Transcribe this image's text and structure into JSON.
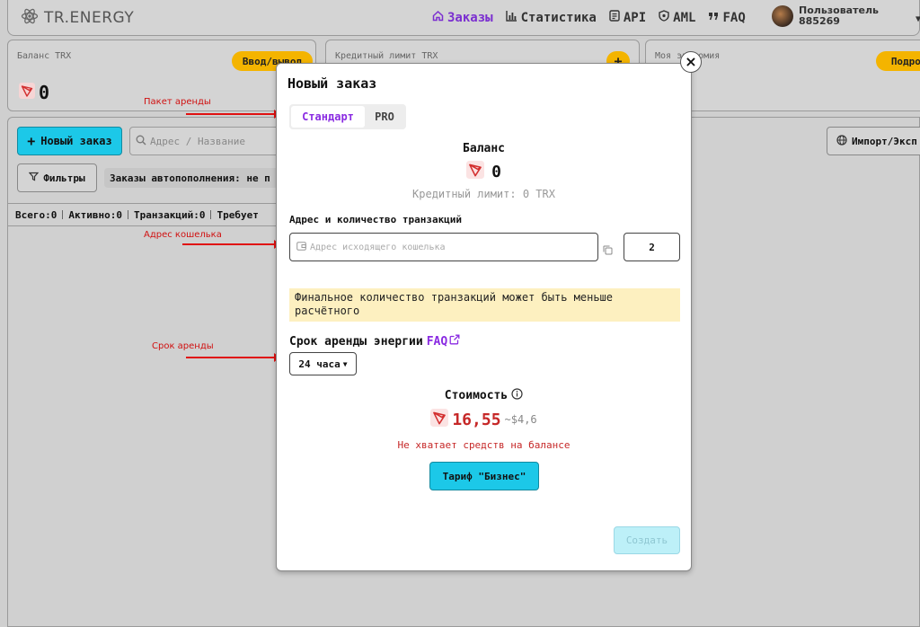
{
  "header": {
    "logo": "TR.ENERGY",
    "nav": [
      {
        "label": "Заказы",
        "icon": "home-icon",
        "active": true
      },
      {
        "label": "Статистика",
        "icon": "bar-chart-icon",
        "active": false
      },
      {
        "label": "API",
        "icon": "document-icon",
        "active": false
      },
      {
        "label": "AML",
        "icon": "shield-icon",
        "active": false
      },
      {
        "label": "FAQ",
        "icon": "quote-icon",
        "active": false
      }
    ],
    "user": {
      "line1": "Пользователь",
      "line2": "885269"
    }
  },
  "cards": [
    {
      "label": "Баланс TRX",
      "button": "Ввод/вывод",
      "value": "0"
    },
    {
      "label": "Кредитный лимит TRX",
      "button": "+"
    },
    {
      "label": "Моя экономия",
      "button": "Подробн"
    }
  ],
  "toolbar": {
    "new_order": "Новый заказ",
    "search_placeholder": "Адрес / Название",
    "import": "Импорт/Эксп",
    "filters": "Фильтры",
    "autofill_chip": "Заказы автопополнения: не п"
  },
  "stats": [
    {
      "label": "Всего:",
      "value": "0"
    },
    {
      "label": "Активно:",
      "value": "0"
    },
    {
      "label": "Транзакций:",
      "value": "0"
    },
    {
      "label": "Требует",
      "value": ""
    }
  ],
  "annotations": {
    "package": "Пакет аренды",
    "wallet": "Адрес кошелька",
    "term": "Срок аренды"
  },
  "modal": {
    "title": "Новый заказ",
    "tabs": [
      {
        "label": "Стандарт",
        "active": true
      },
      {
        "label": "PRO",
        "active": false
      }
    ],
    "balance_label": "Баланс",
    "balance_value": "0",
    "credit_limit": "Кредитный лимит: 0 TRX",
    "address_label": "Адрес и количество транзакций",
    "address_placeholder": "Адрес исходящего кошелька",
    "quantity": "2",
    "warning": "Финальное количество транзакций может быть меньше расчётного",
    "term_label": "Срок аренды энергии",
    "term_faq": "FAQ",
    "term_value": "24 часа",
    "cost_label": "Стоимость",
    "cost_value": "16,55",
    "cost_usd": "~$4,6",
    "insufficient": "Не хватает средств на балансе",
    "tariff_button": "Тариф \"Бизнес\"",
    "create_button": "Создать",
    "close": "×"
  },
  "colors": {
    "accent": "#7b2fd0",
    "primary_button": "#1cc8e8",
    "tron_red": "#c62828",
    "warning_bg": "#fdf0c0",
    "badge": "#f4b400"
  }
}
